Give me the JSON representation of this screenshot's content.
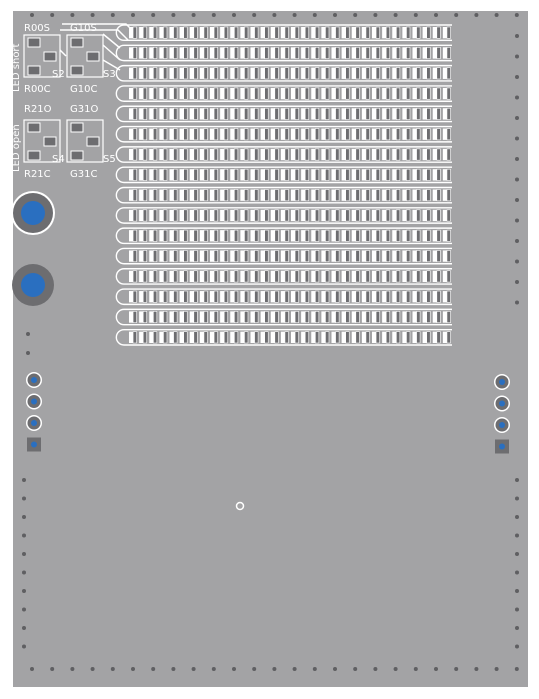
{
  "board": {
    "colors": {
      "outline": "#ffffff",
      "substrate": "#a3a3a5",
      "copper": "#a3a3a5",
      "silk": "#ffffff",
      "pad_dark": "#6d6d70",
      "drill": "#2a6fc0",
      "via": "#5f5f62"
    }
  },
  "labels": {
    "group_short": "LED short",
    "group_open": "LED open",
    "r00s": "R00S",
    "g10s": "G10S",
    "r00c": "R00C",
    "g10c": "G10C",
    "s2": "S2",
    "s3": "S3",
    "r21o": "R21O",
    "g31o": "G31O",
    "r21c": "R21C",
    "g31c": "G31C",
    "s4": "S4",
    "s5": "S5"
  },
  "led_matrix": {
    "rows": 16,
    "columns": 32,
    "icon": "led-matrix-icon"
  },
  "connectors": {
    "left_header_pins": 4,
    "right_header_pins": 4
  }
}
